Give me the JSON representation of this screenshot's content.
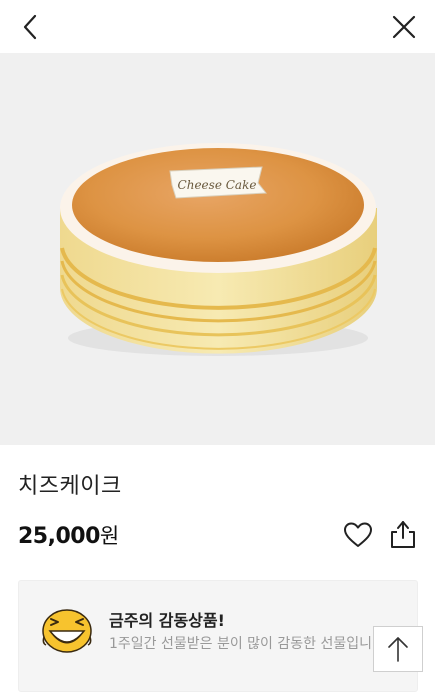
{
  "header": {
    "back_icon": "chevron-left-icon",
    "close_icon": "close-icon"
  },
  "product": {
    "image_alt": "Cheese Cake",
    "topper_text": "Cheese Cake",
    "name": "치즈케이크",
    "price_amount": "25,000",
    "price_unit": "원"
  },
  "actions": {
    "like_icon": "heart-icon",
    "share_icon": "share-icon"
  },
  "promo": {
    "title": "금주의 감동상품!",
    "description": "1주일간 선물받은 분이 많이 감동한 선물입니다."
  },
  "floating": {
    "scroll_top_icon": "arrow-up-icon"
  },
  "colors": {
    "background": "#ffffff",
    "hero_bg": "#f0f0f0",
    "promo_bg": "#f5f5f5",
    "text": "#222222",
    "muted": "#999999"
  }
}
